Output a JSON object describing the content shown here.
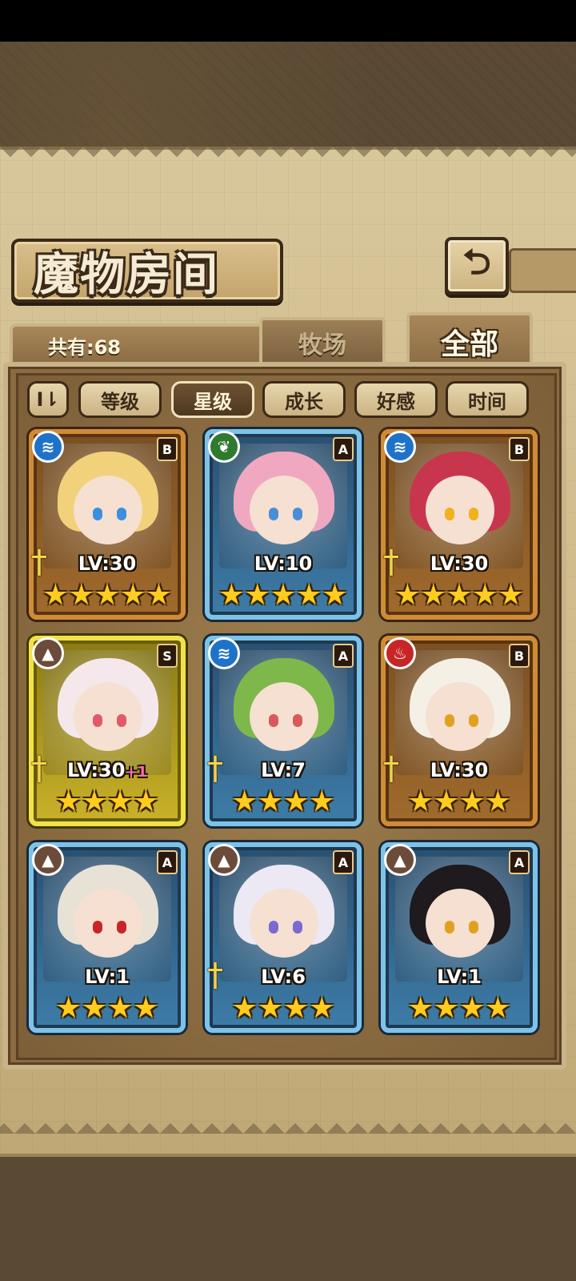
{
  "title": "魔物房间",
  "back_icon": "back-arrow-icon",
  "count_label": "共有:68",
  "tabs": [
    {
      "label": "牧场",
      "active": false
    },
    {
      "label": "全部",
      "active": true
    }
  ],
  "sort_toggle": "I⇂",
  "filters": [
    {
      "label": "等级",
      "active": false
    },
    {
      "label": "星级",
      "active": true
    },
    {
      "label": "成长",
      "active": false
    },
    {
      "label": "好感",
      "active": false
    },
    {
      "label": "时间",
      "active": false
    }
  ],
  "monsters": [
    {
      "element": "water",
      "rank": "B",
      "level": "LV:30",
      "plus": "",
      "stars": 5,
      "has_weapon": true,
      "hair": "#f1d27a",
      "eye": "#3b8fe0"
    },
    {
      "element": "wood",
      "rank": "A",
      "level": "LV:10",
      "plus": "",
      "stars": 5,
      "has_weapon": false,
      "hair": "#f0a8c0",
      "eye": "#4a8fd6"
    },
    {
      "element": "water",
      "rank": "B",
      "level": "LV:30",
      "plus": "",
      "stars": 5,
      "has_weapon": true,
      "hair": "#c8364e",
      "eye": "#f0b21e"
    },
    {
      "element": "earth",
      "rank": "S",
      "level": "LV:30",
      "plus": "+1",
      "stars": 4,
      "has_weapon": true,
      "hair": "#f4e8ec",
      "eye": "#e05a6a"
    },
    {
      "element": "water",
      "rank": "A",
      "level": "LV:7",
      "plus": "",
      "stars": 4,
      "has_weapon": true,
      "hair": "#7fb84a",
      "eye": "#d65a5a"
    },
    {
      "element": "fire",
      "rank": "B",
      "level": "LV:30",
      "plus": "",
      "stars": 4,
      "has_weapon": true,
      "hair": "#f4f0e6",
      "eye": "#e0a21e"
    },
    {
      "element": "earth",
      "rank": "A",
      "level": "LV:1",
      "plus": "",
      "stars": 4,
      "has_weapon": false,
      "hair": "#e8e2d6",
      "eye": "#c82626"
    },
    {
      "element": "earth",
      "rank": "A",
      "level": "LV:6",
      "plus": "",
      "stars": 4,
      "has_weapon": true,
      "hair": "#ece8f4",
      "eye": "#7a6ad0"
    },
    {
      "element": "earth",
      "rank": "A",
      "level": "LV:1",
      "plus": "",
      "stars": 4,
      "has_weapon": false,
      "hair": "#1e1a1e",
      "eye": "#e0a21e"
    }
  ],
  "element_icons": {
    "water": "≋",
    "wood": "❦",
    "earth": "▲",
    "fire": "♨"
  },
  "colors": {
    "accent": "#3b2a18",
    "star": "#ffcc1f"
  }
}
